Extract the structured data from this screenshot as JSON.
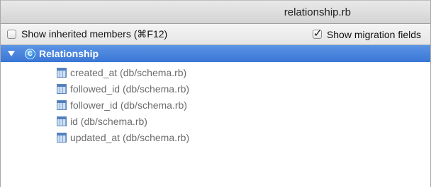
{
  "window": {
    "title": "relationship.rb"
  },
  "options": {
    "inherited_label": "Show inherited members (⌘F12)",
    "inherited_checked": false,
    "migration_label": "Show migration fields",
    "migration_checked": true
  },
  "tree": {
    "class_badge": "C",
    "class_name": "Relationship",
    "fields": [
      {
        "label": "created_at (db/schema.rb)",
        "icon": "table-column-icon"
      },
      {
        "label": "followed_id (db/schema.rb)",
        "icon": "table-column-icon"
      },
      {
        "label": "follower_id (db/schema.rb)",
        "icon": "table-column-icon"
      },
      {
        "label": "id (db/schema.rb)",
        "icon": "table-column-icon"
      },
      {
        "label": "updated_at (db/schema.rb)",
        "icon": "table-column-icon"
      }
    ]
  }
}
